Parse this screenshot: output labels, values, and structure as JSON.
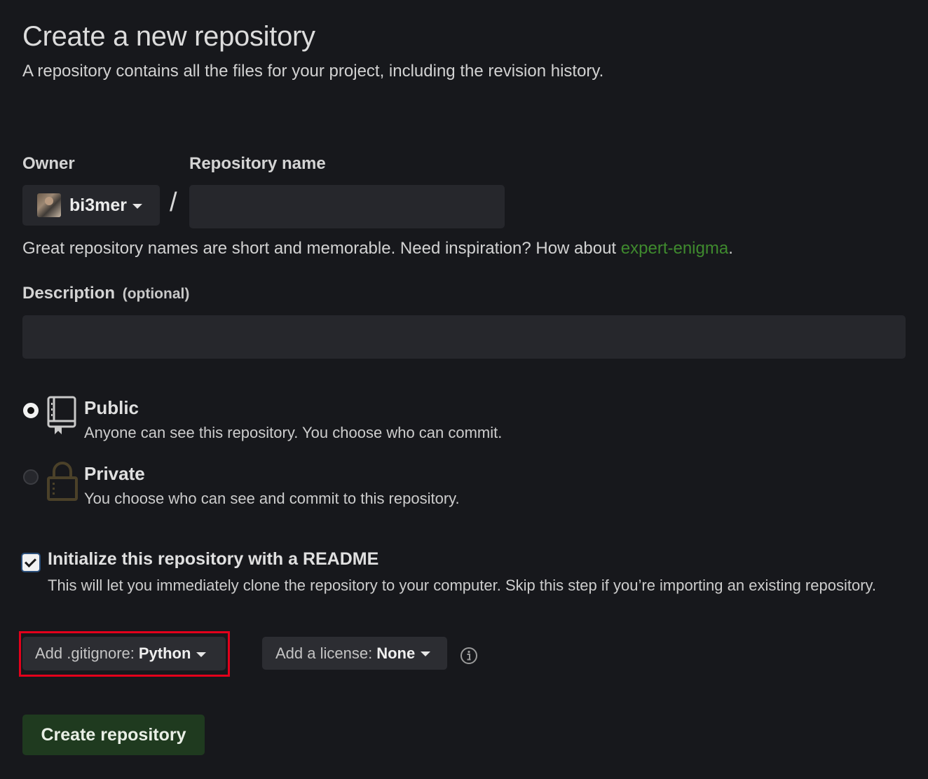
{
  "header": {
    "title": "Create a new repository",
    "subtitle": "A repository contains all the files for your project, including the revision history."
  },
  "owner": {
    "label": "Owner",
    "value": "bi3mer"
  },
  "separator": "/",
  "repository_name": {
    "label": "Repository name",
    "value": "",
    "placeholder": ""
  },
  "name_hint": {
    "prefix": "Great repository names are short and memorable. Need inspiration? How about ",
    "suggestion": "expert-enigma",
    "suffix": "."
  },
  "description": {
    "label": "Description",
    "optional": "(optional)",
    "value": "",
    "placeholder": ""
  },
  "visibility": {
    "selected": "public",
    "options": [
      {
        "id": "public",
        "title": "Public",
        "description": "Anyone can see this repository. You choose who can commit.",
        "icon": "repo-icon"
      },
      {
        "id": "private",
        "title": "Private",
        "description": "You choose who can see and commit to this repository.",
        "icon": "lock-icon"
      }
    ]
  },
  "readme": {
    "checked": true,
    "title": "Initialize this repository with a README",
    "description": "This will let you immediately clone the repository to your computer. Skip this step if you’re importing an existing repository."
  },
  "gitignore": {
    "label": "Add .gitignore:",
    "value": "Python"
  },
  "license": {
    "label": "Add a license:",
    "value": "None"
  },
  "submit": {
    "label": "Create repository"
  },
  "colors": {
    "background": "#17181c",
    "input_background": "#26272c",
    "suggestion_green": "#3f8a2e",
    "create_button": "#1f3a1f",
    "highlight_red": "#e3001b"
  }
}
